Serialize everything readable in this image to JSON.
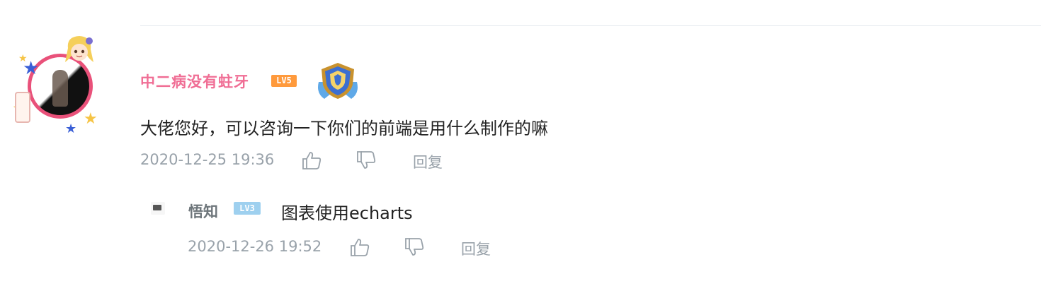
{
  "comment": {
    "username": "中二病没有蛀牙",
    "level": "LV5",
    "text": "大佬您好，可以咨询一下你们的前端是用什么制作的嘛",
    "date": "2020-12-25 19:36",
    "reply_label": "回复",
    "colors": {
      "username": "#f06e95",
      "level_badge": "#ff9a3c",
      "avatar_ring": "#e9517a"
    },
    "icons": [
      "like-icon",
      "dislike-icon",
      "medal-icon"
    ]
  },
  "reply": {
    "username": "悟知",
    "level": "LV3",
    "text": "图表使用echarts",
    "date": "2020-12-26 19:52",
    "reply_label": "回复",
    "colors": {
      "username": "#6d757a",
      "level_badge": "#9ed0ef"
    },
    "icons": [
      "like-icon",
      "dislike-icon"
    ]
  }
}
